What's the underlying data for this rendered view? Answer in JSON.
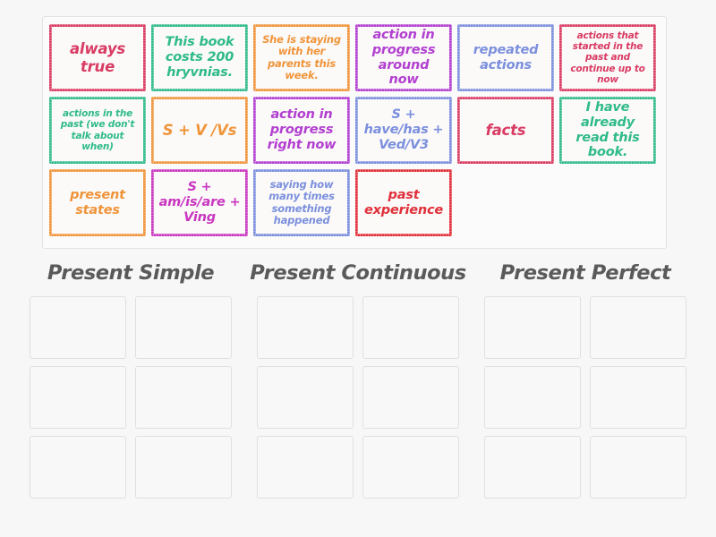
{
  "activity": {
    "type": "group-sort",
    "tray_label": "word-tiles-tray"
  },
  "colors": {
    "crimson": "#d93b63",
    "green": "#2fba8a",
    "orange": "#f0943a",
    "purple": "#b23fd0",
    "blue": "#7b8fdd",
    "red": "#e0303a",
    "magenta": "#c936c0",
    "tray_background": "#fbfbfb",
    "page_background": "#f7f7f7",
    "slot_border": "#e0e0e0",
    "title_color": "#5a5a5a"
  },
  "tiles": [
    {
      "text": "always true",
      "color": "#d93b63",
      "size": "lg"
    },
    {
      "text": "This book costs 200 hryvnias.",
      "color": "#2fba8a",
      "size": "md"
    },
    {
      "text": "She is staying with her parents this week.",
      "color": "#f0943a",
      "size": "sm"
    },
    {
      "text": "action in progress around now",
      "color": "#b23fd0",
      "size": "md"
    },
    {
      "text": "repeated actions",
      "color": "#7b8fdd",
      "size": "md"
    },
    {
      "text": "actions that started in the past and continue up to now",
      "color": "#d93b63",
      "size": "xs"
    },
    {
      "text": "actions in the past (we don't talk about when)",
      "color": "#2fba8a",
      "size": "xs"
    },
    {
      "text": "S + V /Vs",
      "color": "#f0943a",
      "size": "lg"
    },
    {
      "text": "action in progress right now",
      "color": "#b23fd0",
      "size": "md"
    },
    {
      "text": "S + have/has + Ved/V3",
      "color": "#7b8fdd",
      "size": "md"
    },
    {
      "text": "facts",
      "color": "#d93b63",
      "size": "lg"
    },
    {
      "text": "I have already read this book.",
      "color": "#2fba8a",
      "size": "md"
    },
    {
      "text": "present states",
      "color": "#f0943a",
      "size": "md"
    },
    {
      "text": "S + am/is/are + Ving",
      "color": "#c936c0",
      "size": "md"
    },
    {
      "text": "saying how many times something happened",
      "color": "#7b8fdd",
      "size": "sm"
    },
    {
      "text": "past experience",
      "color": "#e0303a",
      "size": "md"
    }
  ],
  "columns": [
    {
      "title": "Present Simple",
      "slots": [
        "",
        "",
        "",
        "",
        "",
        ""
      ]
    },
    {
      "title": "Present Continuous",
      "slots": [
        "",
        "",
        "",
        "",
        "",
        ""
      ]
    },
    {
      "title": "Present Perfect",
      "slots": [
        "",
        "",
        "",
        "",
        "",
        ""
      ]
    }
  ]
}
